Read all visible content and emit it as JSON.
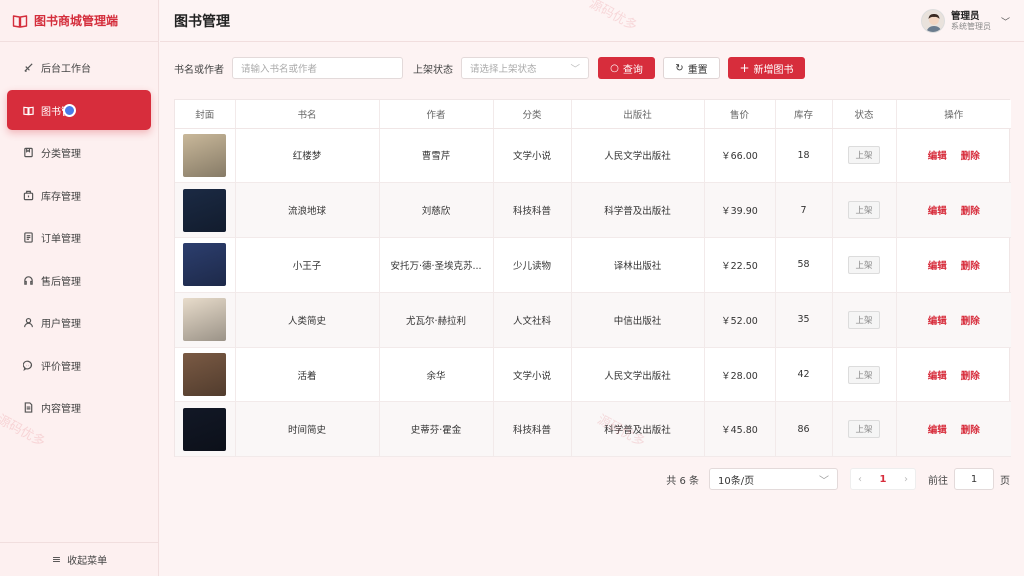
{
  "app": {
    "brand": "图书商城管理端"
  },
  "sidebar": {
    "items": [
      {
        "label": "后台工作台",
        "icon": "dashboard-icon"
      },
      {
        "label": "图书管",
        "icon": "book-icon",
        "active": true
      },
      {
        "label": "分类管理",
        "icon": "category-icon"
      },
      {
        "label": "库存管理",
        "icon": "inventory-icon"
      },
      {
        "label": "订单管理",
        "icon": "order-icon"
      },
      {
        "label": "售后管理",
        "icon": "headset-icon"
      },
      {
        "label": "用户管理",
        "icon": "user-icon"
      },
      {
        "label": "评价管理",
        "icon": "comment-icon"
      },
      {
        "label": "内容管理",
        "icon": "content-icon"
      }
    ],
    "collapse_label": "收起菜单"
  },
  "header": {
    "title": "图书管理",
    "user_name": "管理员",
    "user_role": "系统管理员"
  },
  "filters": {
    "keyword_label": "书名或作者",
    "keyword_placeholder": "请输入书名或作者",
    "status_label": "上架状态",
    "status_placeholder": "请选择上架状态",
    "search_label": "查询",
    "reset_label": "重置",
    "add_label": "新增图书"
  },
  "table": {
    "columns": [
      "封面",
      "书名",
      "作者",
      "分类",
      "出版社",
      "售价",
      "库存",
      "状态",
      "操作"
    ],
    "rows": [
      {
        "title": "红楼梦",
        "author": "曹雪芹",
        "category": "文学小说",
        "publisher": "人民文学出版社",
        "price": "￥66.00",
        "stock": "18",
        "status": "上架",
        "cover_color": "#c9b89a"
      },
      {
        "title": "流浪地球",
        "author": "刘慈欣",
        "category": "科技科普",
        "publisher": "科学普及出版社",
        "price": "￥39.90",
        "stock": "7",
        "status": "上架",
        "cover_color": "#1b2a44"
      },
      {
        "title": "小王子",
        "author": "安托万·德·圣埃克苏...",
        "category": "少儿读物",
        "publisher": "译林出版社",
        "price": "￥22.50",
        "stock": "58",
        "status": "上架",
        "cover_color": "#2c3e6e"
      },
      {
        "title": "人类简史",
        "author": "尤瓦尔·赫拉利",
        "category": "人文社科",
        "publisher": "中信出版社",
        "price": "￥52.00",
        "stock": "35",
        "status": "上架",
        "cover_color": "#e8dccb"
      },
      {
        "title": "活着",
        "author": "余华",
        "category": "文学小说",
        "publisher": "人民文学出版社",
        "price": "￥28.00",
        "stock": "42",
        "status": "上架",
        "cover_color": "#7a5a44"
      },
      {
        "title": "时间简史",
        "author": "史蒂芬·霍金",
        "category": "科技科普",
        "publisher": "科学普及出版社",
        "price": "￥45.80",
        "stock": "86",
        "status": "上架",
        "cover_color": "#121826"
      }
    ],
    "edit_label": "编辑",
    "delete_label": "删除"
  },
  "pagination": {
    "total": "共 6 条",
    "page_size": "10条/页",
    "prev": "‹",
    "current": "1",
    "next": "›",
    "goto_label": "前往",
    "goto_value": "1",
    "page_suffix": "页"
  },
  "watermark": {
    "text": "源码优多"
  },
  "colors": {
    "accent": "#d72d3c",
    "background": "#fdf3f3"
  }
}
